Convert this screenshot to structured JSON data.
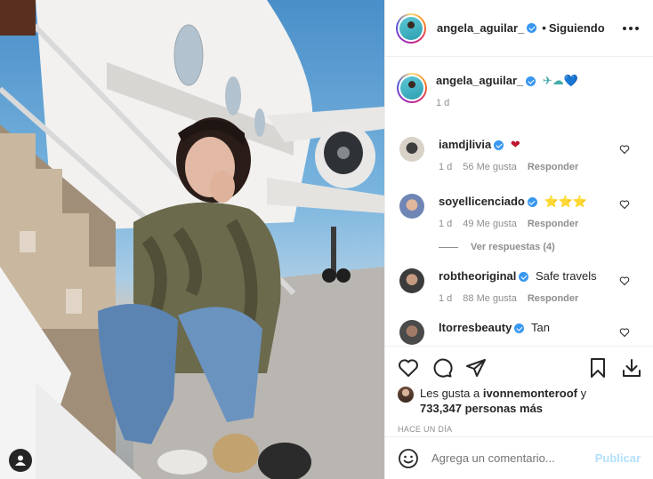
{
  "post": {
    "author": "angela_aguilar_",
    "follow_status": "Siguiendo",
    "caption_text": "✈☁💙",
    "caption_time": "1 d"
  },
  "comments": [
    {
      "user": "iamdjlivia",
      "verified": true,
      "text": "❤",
      "time": "1 d",
      "likes": "56 Me gusta",
      "reply": "Responder",
      "avatar_color": "#d6d0c8"
    },
    {
      "user": "soyellicenciado",
      "verified": true,
      "text": "⭐⭐⭐",
      "time": "1 d",
      "likes": "49 Me gusta",
      "reply": "Responder",
      "avatar_color": "#6f86b5"
    },
    {
      "user": "robtheoriginal",
      "verified": true,
      "text": "Safe travels",
      "time": "1 d",
      "likes": "88 Me gusta",
      "reply": "Responder",
      "avatar_color": "#4b4b4b"
    },
    {
      "user": "ltorresbeauty",
      "verified": true,
      "text": "Tan",
      "time": "",
      "likes": "",
      "reply": "",
      "avatar_color": "#5a5a5a"
    }
  ],
  "view_replies": "Ver respuestas (4)",
  "likes": {
    "prefix": "Les gusta a ",
    "user": "ivonnemonteroof",
    "middle": " y",
    "count": "733,347 personas",
    "suffix": " más"
  },
  "timestamp": "HACE UN DÍA",
  "comment_box": {
    "placeholder": "Agrega un comentario...",
    "post_label": "Publicar"
  },
  "icons": {
    "more": "more-options-icon",
    "like": "heart-icon",
    "comment": "comment-icon",
    "share": "share-icon",
    "save": "bookmark-icon",
    "download": "download-icon",
    "emoji": "emoji-icon",
    "profile": "user-icon"
  },
  "colors": {
    "verified": "#3897f0",
    "post_button": "#b2dffc",
    "secondary_text": "#8e8e8e"
  }
}
